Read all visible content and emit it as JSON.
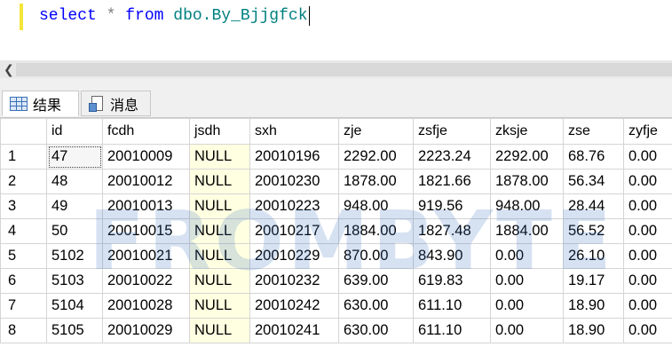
{
  "editor": {
    "keyword_select": "select",
    "star": "*",
    "keyword_from": "from",
    "table_ref": "dbo.By_Bjjgfck"
  },
  "tabs": {
    "results_label": "结果",
    "messages_label": "消息"
  },
  "grid": {
    "columns": [
      "id",
      "fcdh",
      "jsdh",
      "sxh",
      "zje",
      "zsfje",
      "zksje",
      "zse",
      "zyfje"
    ],
    "rows": [
      {
        "n": "1",
        "id": "47",
        "fcdh": "20010009",
        "jsdh": "NULL",
        "sxh": "20010196",
        "zje": "2292.00",
        "zsfje": "2223.24",
        "zksje": "2292.00",
        "zse": "68.76",
        "zyfje": "0.00"
      },
      {
        "n": "2",
        "id": "48",
        "fcdh": "20010012",
        "jsdh": "NULL",
        "sxh": "20010230",
        "zje": "1878.00",
        "zsfje": "1821.66",
        "zksje": "1878.00",
        "zse": "56.34",
        "zyfje": "0.00"
      },
      {
        "n": "3",
        "id": "49",
        "fcdh": "20010013",
        "jsdh": "NULL",
        "sxh": "20010223",
        "zje": "948.00",
        "zsfje": "919.56",
        "zksje": "948.00",
        "zse": "28.44",
        "zyfje": "0.00"
      },
      {
        "n": "4",
        "id": "50",
        "fcdh": "20010015",
        "jsdh": "NULL",
        "sxh": "20010217",
        "zje": "1884.00",
        "zsfje": "1827.48",
        "zksje": "1884.00",
        "zse": "56.52",
        "zyfje": "0.00"
      },
      {
        "n": "5",
        "id": "5102",
        "fcdh": "20010021",
        "jsdh": "NULL",
        "sxh": "20010229",
        "zje": "870.00",
        "zsfje": "843.90",
        "zksje": "0.00",
        "zse": "26.10",
        "zyfje": "0.00"
      },
      {
        "n": "6",
        "id": "5103",
        "fcdh": "20010022",
        "jsdh": "NULL",
        "sxh": "20010232",
        "zje": "639.00",
        "zsfje": "619.83",
        "zksje": "0.00",
        "zse": "19.17",
        "zyfje": "0.00"
      },
      {
        "n": "7",
        "id": "5104",
        "fcdh": "20010028",
        "jsdh": "NULL",
        "sxh": "20010242",
        "zje": "630.00",
        "zsfje": "611.10",
        "zksje": "0.00",
        "zse": "18.90",
        "zyfje": "0.00"
      },
      {
        "n": "8",
        "id": "5105",
        "fcdh": "20010029",
        "jsdh": "NULL",
        "sxh": "20010241",
        "zje": "630.00",
        "zsfje": "611.10",
        "zksje": "0.00",
        "zse": "18.90",
        "zyfje": "0.00"
      }
    ]
  },
  "watermark": "FROMBYTE"
}
